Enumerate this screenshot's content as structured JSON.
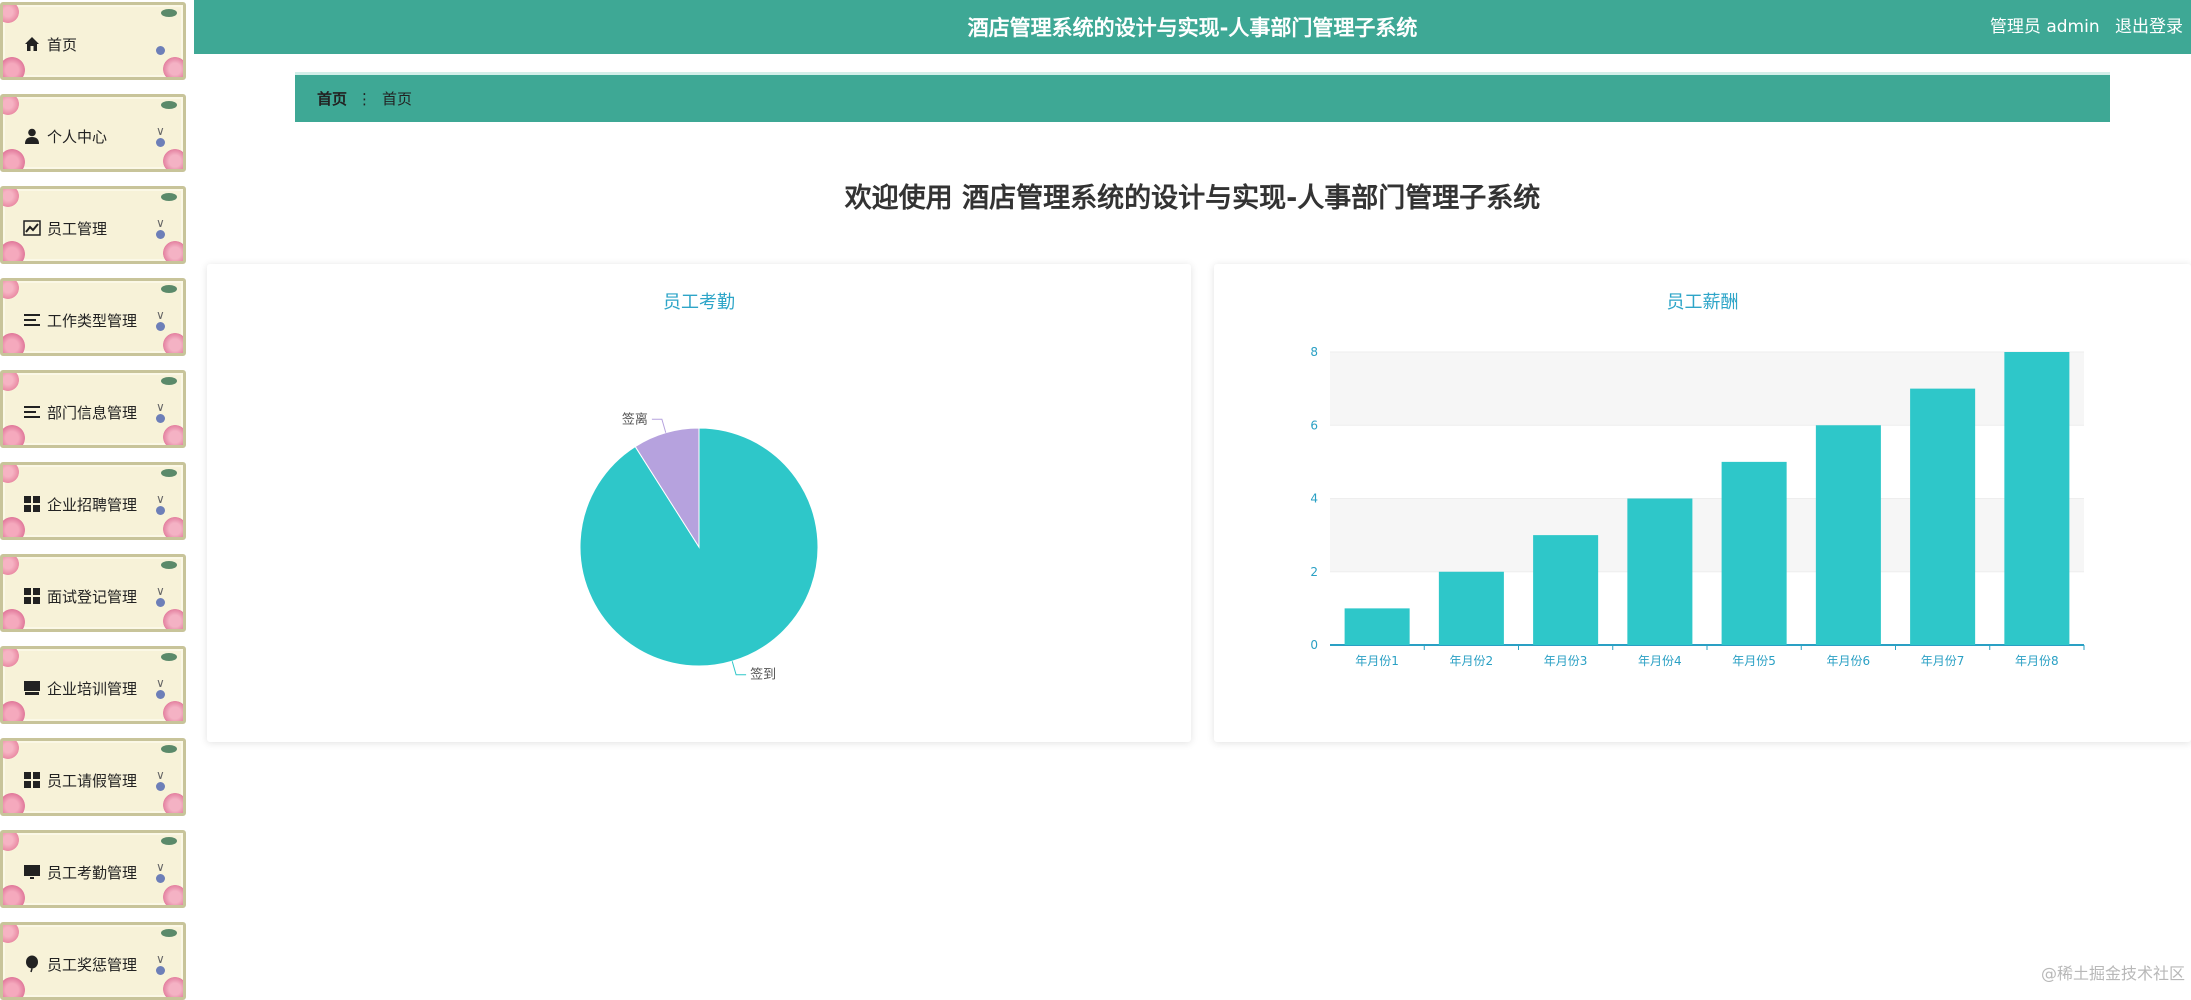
{
  "header": {
    "title": "酒店管理系统的设计与实现-人事部门管理子系统",
    "user_label": "管理员 admin",
    "logout_label": "退出登录"
  },
  "sidebar": {
    "items": [
      {
        "label": "首页",
        "icon": "home-icon",
        "chevron": false
      },
      {
        "label": "个人中心",
        "icon": "user-icon",
        "chevron": true
      },
      {
        "label": "员工管理",
        "icon": "trend-chart-icon",
        "chevron": true
      },
      {
        "label": "工作类型管理",
        "icon": "list-icon",
        "chevron": true
      },
      {
        "label": "部门信息管理",
        "icon": "list-icon",
        "chevron": true
      },
      {
        "label": "企业招聘管理",
        "icon": "grid-icon",
        "chevron": true
      },
      {
        "label": "面试登记管理",
        "icon": "grid-icon",
        "chevron": true
      },
      {
        "label": "企业培训管理",
        "icon": "board-icon",
        "chevron": true
      },
      {
        "label": "员工请假管理",
        "icon": "grid-icon",
        "chevron": true
      },
      {
        "label": "员工考勤管理",
        "icon": "monitor-icon",
        "chevron": true
      },
      {
        "label": "员工奖惩管理",
        "icon": "balloon-icon",
        "chevron": true
      }
    ]
  },
  "breadcrumb": {
    "home": "首页",
    "separator": "⋮",
    "current": "首页"
  },
  "main": {
    "welcome": "欢迎使用 酒店管理系统的设计与实现-人事部门管理子系统"
  },
  "chart_data": [
    {
      "type": "pie",
      "title": "员工考勤",
      "slices": [
        {
          "label": "签到",
          "value": 91,
          "color": "#2ec7c9"
        },
        {
          "label": "签离",
          "value": 9,
          "color": "#b6a2de"
        }
      ]
    },
    {
      "type": "bar",
      "title": "员工薪酬",
      "categories": [
        "年月份1",
        "年月份2",
        "年月份3",
        "年月份4",
        "年月份5",
        "年月份6",
        "年月份7",
        "年月份8"
      ],
      "values": [
        1,
        2,
        3,
        4,
        5,
        6,
        7,
        8
      ],
      "ylim": [
        0,
        8
      ],
      "yticks": [
        0,
        2,
        4,
        6,
        8
      ],
      "color": "#2ec7c9",
      "grid": true
    }
  ],
  "watermark": "@稀土掘金技术社区"
}
